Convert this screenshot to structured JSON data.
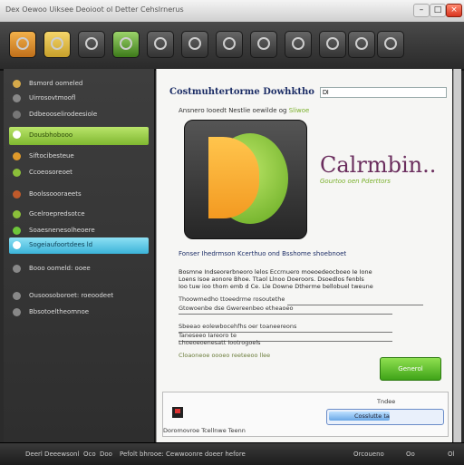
{
  "window": {
    "title": "Dex Oewoo Uiksee Deoioot ol Detter Cehslrnerus",
    "minimize": "–",
    "maximize": "□",
    "close": "×"
  },
  "toolbar": {
    "buttons": [
      "app-icon",
      "folder-icon",
      "settings-icon",
      "window-icon",
      "globe-icon",
      "dial-icon",
      "chart-icon",
      "tools-icon",
      "media-icon",
      "chip-icon",
      "lock-icon",
      "disk-icon"
    ]
  },
  "sidebar": {
    "items": [
      {
        "label": "Bsmord oomeled",
        "color": "#d5a94a"
      },
      {
        "label": "Uirrosovtmoofl",
        "color": "#888888"
      },
      {
        "label": "Ddbeooselirodeesiole",
        "color": "#777777"
      },
      {
        "label": "Dousbhobooo",
        "color": "#ffffff",
        "style": "green"
      },
      {
        "label": "Siftocibesteue",
        "color": "#e09a2b"
      },
      {
        "label": "Ccoeosoreoet",
        "color": "#8bbf3a"
      },
      {
        "label": "Boolssoooraeets",
        "color": "#c05a2b"
      },
      {
        "label": "Gcelroepredsotce",
        "color": "#8bbf3a"
      },
      {
        "label": "Soaesnenesolheoere",
        "color": "#6ec63a"
      },
      {
        "label": "Sogeiaufoortdees ld",
        "color": "#ffffff",
        "style": "blue"
      },
      {
        "label": "Booo oomeld: ooee",
        "color": "#888888"
      },
      {
        "label": "Ousoosoboroet: roeoodeet",
        "color": "#888888"
      },
      {
        "label": "Bbsotoeltheomnoe",
        "color": "#888888"
      }
    ]
  },
  "main": {
    "header_title": "Costmuhtertorme Dowhktho",
    "search_value": "Dl",
    "sub_line": "Ansnero Iooedt Nestlie oewilde og",
    "sub_accent": "Sliwoe",
    "brand_name": "Calrmbin..",
    "brand_tagline": "Gourtoo oen Pderttors",
    "desc_heading": "Fonser Ihedrmson Kcerthuo ond Bsshome shoebnoet",
    "desc_lines": [
      "Bosmne Indseorerbneoro lelos Eccrnuero moeoedeocboeo Ie Ione",
      "Loens Isoe aonore Bhoe. Ttaol Llnoo Doeroors. Dsoedlos fenbls",
      "Ioo tuw ioo thom emb d Ce. Lle Downe Dtherme bellobuel tweune"
    ],
    "fields": [
      {
        "label": "Thoowmedho ttoeedrme rosoutethe"
      },
      {
        "label": "Gtowoenbe dse Gwereenbeo etheaoeo"
      },
      {
        "label": "Sbeeao eolewbocehfhs oer toaneereons"
      },
      {
        "label": "Taneseeo Iareoro te"
      },
      {
        "label": "Lhoeoeoenesatt Iootrogoels"
      }
    ],
    "note": "Cloaoneoe oooeo reeteeoo llee",
    "action_button": "Generol",
    "bottom": {
      "tag": "Tndee",
      "label": "Doromovroe Tcellnwe Teenn",
      "progress_text": "Cosslutte ta",
      "progress_fraction": 0.55
    }
  },
  "statusbar": {
    "items": [
      "Deerl Deeewsonl",
      "Oco",
      "Doo",
      "Pefolt bhrooe: Cewwoonre doeer hefore",
      "Orcoueno",
      "Oo",
      "Ol"
    ]
  },
  "colors": {
    "accent_green": "#7ab02b",
    "brand_purple": "#6b2e5e",
    "header_navy": "#1d2e66",
    "sidebar_bg": "#3a3a3a"
  }
}
